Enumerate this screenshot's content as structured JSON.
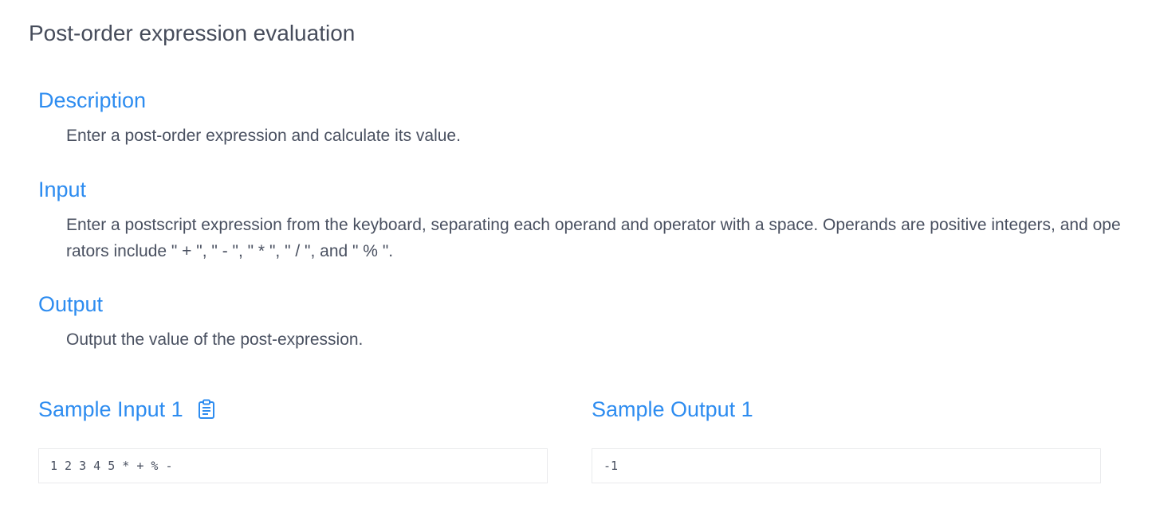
{
  "page": {
    "title": "Post-order expression evaluation"
  },
  "sections": {
    "description": {
      "heading": "Description",
      "body": "Enter a post-order expression and calculate its value."
    },
    "input": {
      "heading": "Input",
      "body": "Enter a postscript expression from the keyboard, separating each operand and operator with a space. Operands are positive integers, and operators include \" + \", \" - \", \" * \", \" / \", and \" % \"."
    },
    "output": {
      "heading": "Output",
      "body": "Output the value of the post-expression."
    }
  },
  "samples": {
    "input_heading": "Sample Input 1",
    "input_value": "1 2 3 4 5 * + % -",
    "output_heading": "Sample Output 1",
    "output_value": "-1",
    "copy_icon": "clipboard-icon"
  },
  "colors": {
    "accent": "#2d8cf0",
    "text": "#495060",
    "title": "#464c5b",
    "border": "#e9eaec"
  }
}
